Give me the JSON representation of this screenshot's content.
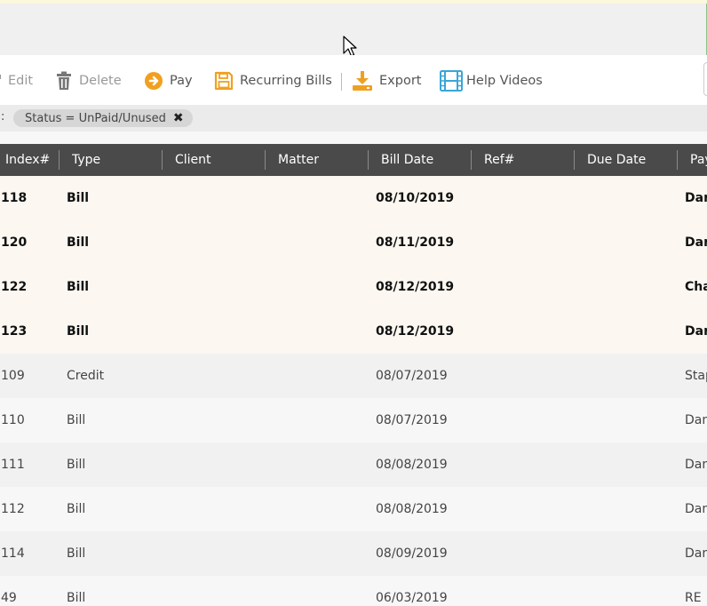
{
  "toolbar": {
    "edit_label": "Edit",
    "delete_label": "Delete",
    "pay_label": "Pay",
    "recurring_label": "Recurring Bills",
    "export_label": "Export",
    "help_label": "Help Videos"
  },
  "filter": {
    "prefix": ":",
    "chip_label": "Status = UnPaid/Unused",
    "remove_glyph": "✖"
  },
  "table": {
    "columns": [
      "Index#",
      "Type",
      "Client",
      "Matter",
      "Bill Date",
      "Ref#",
      "Due Date",
      "Pay"
    ],
    "rows": [
      {
        "index": "118",
        "type": "Bill",
        "client": "",
        "matter": "",
        "bill_date": "08/10/2019",
        "ref": "",
        "due_date": "",
        "payee": "Dar",
        "unread": true
      },
      {
        "index": "120",
        "type": "Bill",
        "client": "",
        "matter": "",
        "bill_date": "08/11/2019",
        "ref": "",
        "due_date": "",
        "payee": "Dar",
        "unread": true
      },
      {
        "index": "122",
        "type": "Bill",
        "client": "",
        "matter": "",
        "bill_date": "08/12/2019",
        "ref": "",
        "due_date": "",
        "payee": "Cha",
        "unread": true
      },
      {
        "index": "123",
        "type": "Bill",
        "client": "",
        "matter": "",
        "bill_date": "08/12/2019",
        "ref": "",
        "due_date": "",
        "payee": "Dar",
        "unread": true
      },
      {
        "index": "109",
        "type": "Credit",
        "client": "",
        "matter": "",
        "bill_date": "08/07/2019",
        "ref": "",
        "due_date": "",
        "payee": "Stap",
        "unread": false
      },
      {
        "index": "110",
        "type": "Bill",
        "client": "",
        "matter": "",
        "bill_date": "08/07/2019",
        "ref": "",
        "due_date": "",
        "payee": "Dan",
        "unread": false
      },
      {
        "index": "111",
        "type": "Bill",
        "client": "",
        "matter": "",
        "bill_date": "08/08/2019",
        "ref": "",
        "due_date": "",
        "payee": "Dan",
        "unread": false
      },
      {
        "index": "112",
        "type": "Bill",
        "client": "",
        "matter": "",
        "bill_date": "08/08/2019",
        "ref": "",
        "due_date": "",
        "payee": "Dan",
        "unread": false
      },
      {
        "index": "114",
        "type": "Bill",
        "client": "",
        "matter": "",
        "bill_date": "08/09/2019",
        "ref": "",
        "due_date": "",
        "payee": "Dan",
        "unread": false
      },
      {
        "index": "49",
        "type": "Bill",
        "client": "",
        "matter": "",
        "bill_date": "06/03/2019",
        "ref": "",
        "due_date": "",
        "payee": "RE",
        "unread": false
      }
    ]
  },
  "colors": {
    "header_bg": "#4b4a4a",
    "unread_row_bg": "#fcf8f1",
    "accent_orange": "#f0a020",
    "accent_teal": "#3aa6d6"
  }
}
